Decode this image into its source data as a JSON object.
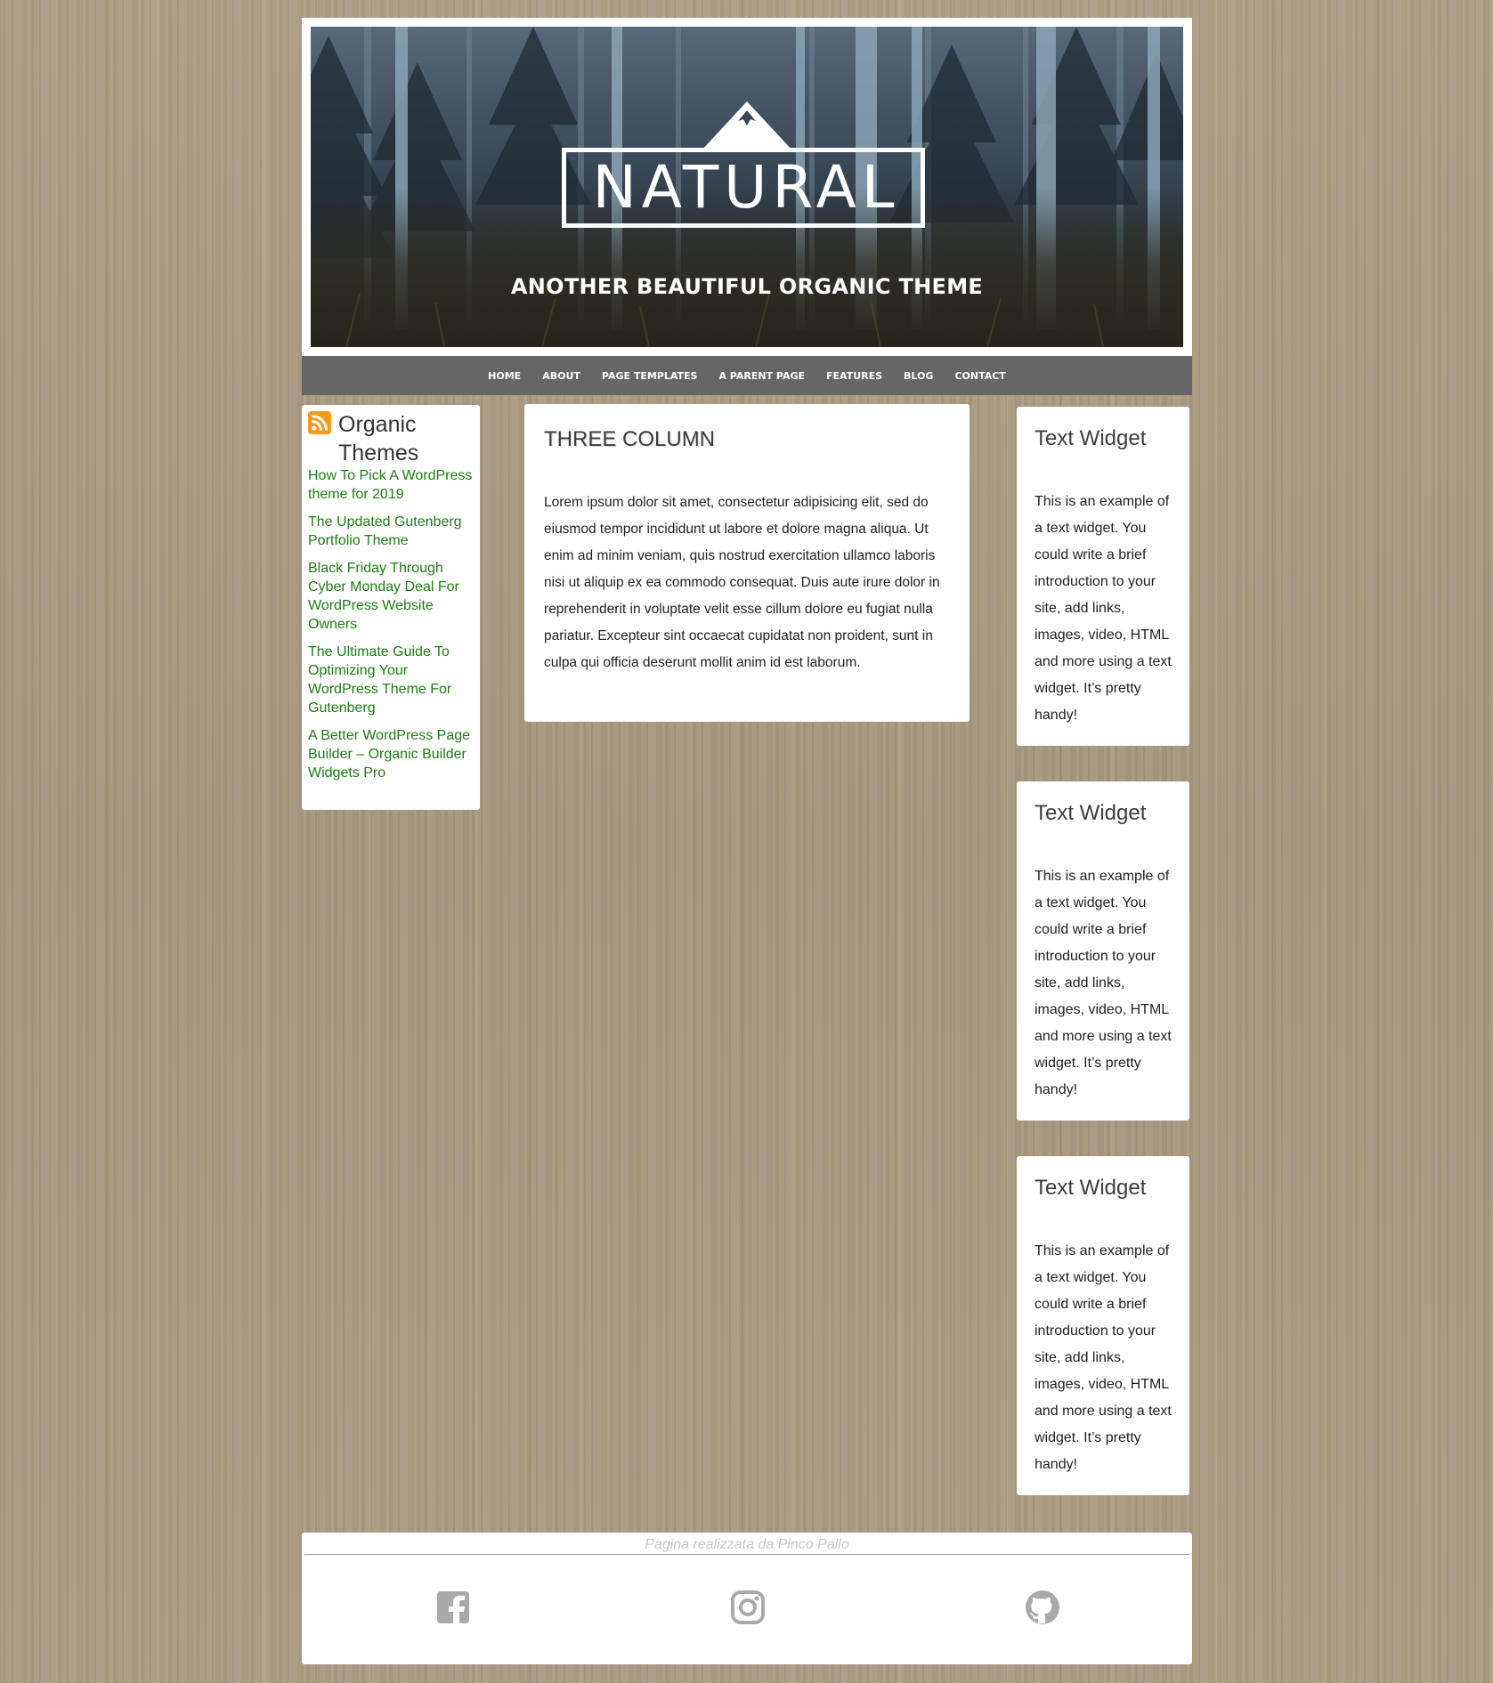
{
  "site": {
    "title": "NATURAL",
    "tagline": "ANOTHER BEAUTIFUL ORGANIC THEME"
  },
  "nav": {
    "items": [
      {
        "label": "HOME"
      },
      {
        "label": "ABOUT"
      },
      {
        "label": "PAGE TEMPLATES"
      },
      {
        "label": "A PARENT PAGE"
      },
      {
        "label": "FEATURES"
      },
      {
        "label": "BLOG"
      },
      {
        "label": "CONTACT"
      }
    ]
  },
  "rss_widget": {
    "title": "Organic Themes",
    "icon": "rss-icon",
    "items": [
      {
        "label": "How To Pick A WordPress theme for 2019"
      },
      {
        "label": "The Updated Gutenberg Portfolio Theme"
      },
      {
        "label": "Black Friday Through Cyber Monday Deal For WordPress Website Owners"
      },
      {
        "label": "The Ultimate Guide To Optimizing Your WordPress Theme For Gutenberg"
      },
      {
        "label": "A Better WordPress Page Builder – Organic Builder Widgets Pro"
      }
    ]
  },
  "main": {
    "title": "THREE COLUMN",
    "body": "Lorem ipsum dolor sit amet, consectetur adipisicing elit, sed do eiusmod tempor incididunt ut labore et dolore magna aliqua. Ut enim ad minim veniam, quis nostrud exercitation ullamco laboris nisi ut aliquip ex ea commodo consequat. Duis aute irure dolor in reprehenderit in voluptate velit esse cillum dolore eu fugiat nulla pariatur. Excepteur sint occaecat cupidatat non proident, sunt in culpa qui officia deserunt mollit anim id est laborum."
  },
  "text_widgets": [
    {
      "title": "Text Widget",
      "body": "This is an example of a text widget. You could write a brief introduction to your site, add links, images, video, HTML and more using a text widget. It’s pretty handy!"
    },
    {
      "title": "Text Widget",
      "body": "This is an example of a text widget. You could write a brief introduction to your site, add links, images, video, HTML and more using a text widget. It’s pretty handy!"
    },
    {
      "title": "Text Widget",
      "body": "This is an example of a text widget. You could write a brief introduction to your site, add links, images, video, HTML and more using a text widget. It’s pretty handy!"
    }
  ],
  "footer": {
    "credit": "Pagina realizzata da Pinco Pallo",
    "social": [
      {
        "icon": "facebook-icon"
      },
      {
        "icon": "instagram-icon"
      },
      {
        "icon": "github-icon"
      }
    ]
  },
  "colors": {
    "link": "#1e7d14",
    "nav_bg": "#666666",
    "rss": "#f49a1d",
    "social_icon": "#a9a9a9"
  }
}
